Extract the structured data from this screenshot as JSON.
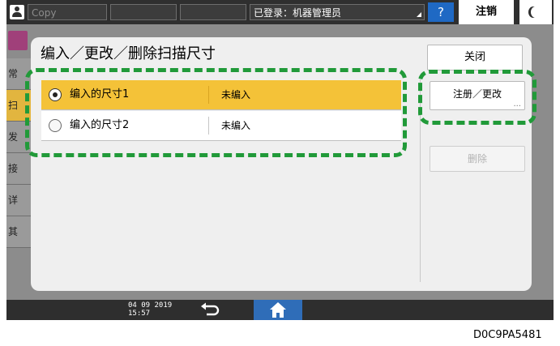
{
  "topbar": {
    "field1": "Copy",
    "login_status": "已登录：机器管理员",
    "help_label": "?",
    "logout_label": "注销"
  },
  "background_app": {
    "sidebar_items": [
      "常",
      "扫",
      "发",
      "接",
      "详",
      "其"
    ]
  },
  "dialog": {
    "title": "编入／更改／删除扫描尺寸",
    "close_label": "关闭",
    "register_label": "注册／更改",
    "register_more": "...",
    "delete_label": "删除",
    "sizes": [
      {
        "name": "编入的尺寸1",
        "status": "未编入",
        "selected": true
      },
      {
        "name": "编入的尺寸2",
        "status": "未编入",
        "selected": false
      }
    ]
  },
  "bottombar": {
    "date": "04 09 2019",
    "time": "15:57"
  },
  "caption": "D0C9PA5481",
  "colors": {
    "selected_row": "#f4c238",
    "highlight": "#219a39",
    "home_button": "#2f6db8",
    "help_button": "#1f69c4"
  },
  "icons": [
    "user-icon",
    "moon-icon",
    "back-arrow-icon",
    "home-icon",
    "radio-selected-icon",
    "radio-empty-icon"
  ]
}
